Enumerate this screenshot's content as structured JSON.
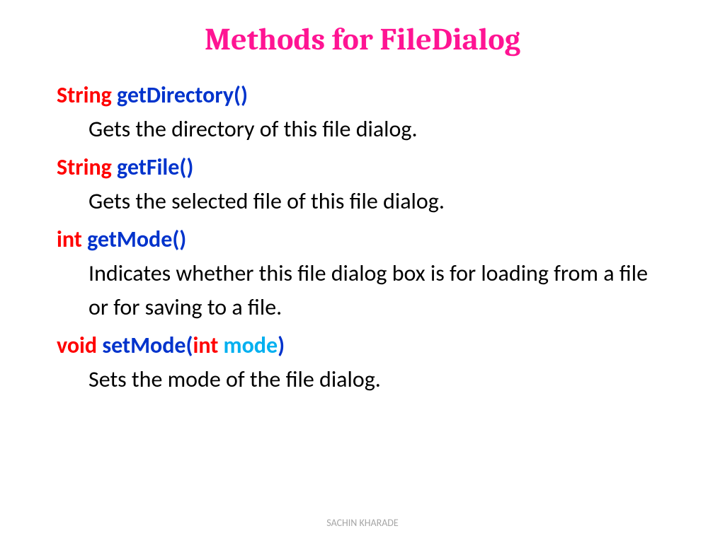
{
  "title": "Methods for FileDialog",
  "methods": [
    {
      "returnType": "String",
      "name": "getDirectory()",
      "desc": "Gets the directory of this file dialog."
    },
    {
      "returnType": "String",
      "name": "getFile()",
      "desc": "Gets the selected file of this file dialog."
    },
    {
      "returnType": "int",
      "name": "getMode()",
      "desc": "Indicates whether this file dialog box is for loading from a file or for saving to a file."
    }
  ],
  "setMode": {
    "returnType": "void",
    "namePrefix": "setMode(",
    "paramType": "int",
    "paramName": " mode",
    "nameSuffix": ")",
    "desc": "Sets the mode of the file dialog."
  },
  "footer": "SACHIN KHARADE"
}
